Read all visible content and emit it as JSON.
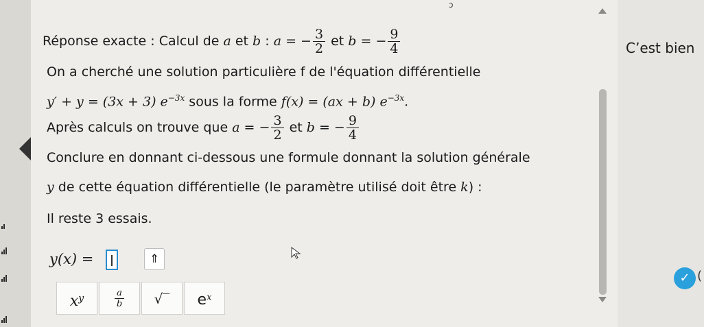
{
  "header": {
    "reponse_prefix": "Réponse exacte : Calcul de ",
    "var_a": "a",
    "et": " et ",
    "var_b": "b",
    "colon": " : ",
    "a_eq": "a = −",
    "b_eq": "b = −",
    "frac_a": {
      "num": "3",
      "den": "2"
    },
    "frac_b": {
      "num": "9",
      "den": "4"
    }
  },
  "feedback": "C’est bien",
  "top_mark": "ɔ",
  "body": {
    "l1": "On a cherché une solution particulière f de l'équation différentielle",
    "l2_eq": "y′ + y = (3x + 3) e",
    "l2_exp": "−3x",
    "l2_mid": " sous la forme ",
    "l2_form": "f(x) = (ax + b) e",
    "l2_form_exp": "−3x",
    "l2_end": ".",
    "l3_text": "Après calculs on trouve que ",
    "l3_a": "a = −",
    "l3_et": " et ",
    "l3_b": "b = −",
    "l4": "Conclure en donnant ci-dessous une formule donnant la solution générale",
    "l5_y": "y",
    "l5_text": " de cette équation différentielle (le paramètre utilisé doit être ",
    "l5_k": "k",
    "l5_end": ") :",
    "l6": "Il reste 3 essais."
  },
  "input": {
    "label": "y(x) =",
    "up_button": "⇑"
  },
  "toolbar": {
    "power_base": "x",
    "power_exp": "y",
    "frac_num": "a",
    "frac_den": "b",
    "sqrt": "√‾",
    "exp_base": "e",
    "exp_exp": "x"
  },
  "check_icon": "✓",
  "check_partial": "(",
  "colors": {
    "accent": "#2a8cd0",
    "check": "#2aa0dc",
    "panel": "#eeedea"
  }
}
